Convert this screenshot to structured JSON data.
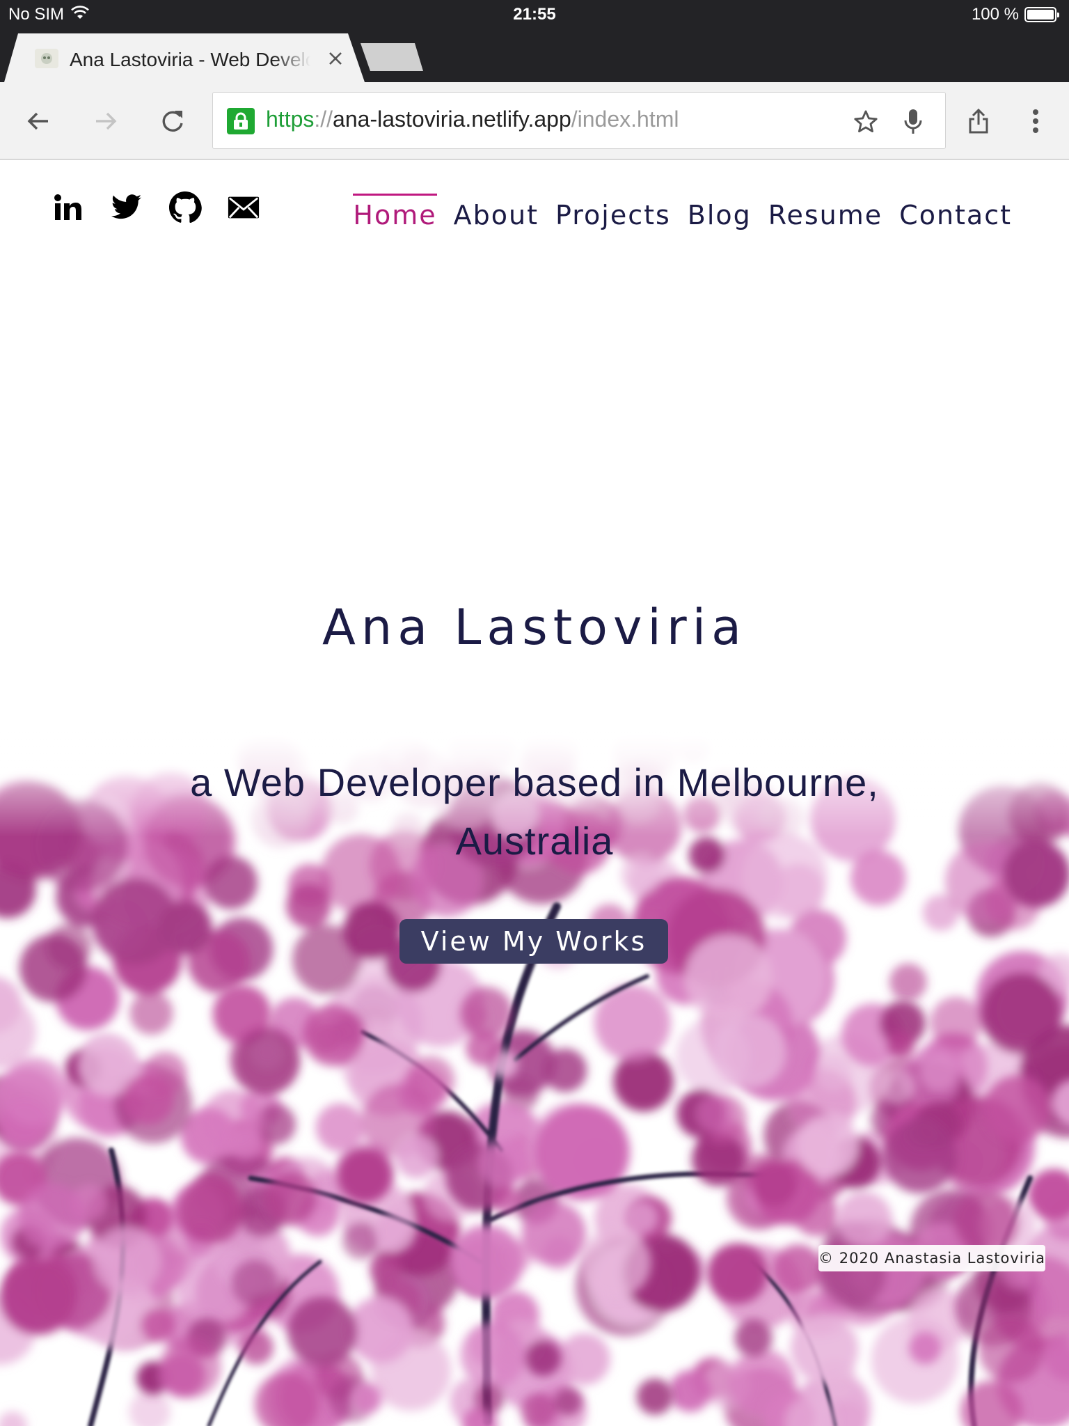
{
  "status_bar": {
    "carrier": "No SIM",
    "time": "21:55",
    "battery_text": "100 %",
    "battery_level": 1.0
  },
  "browser": {
    "active_tab_title": "Ana Lastoviria - Web Developer",
    "url": {
      "scheme": "https",
      "separator": "://",
      "host": "ana-lastoviria.netlify.app",
      "path": "/index.html"
    },
    "colors": {
      "secure": "#1fa932",
      "chrome": "#232326",
      "toolbar": "#f2f2f2"
    }
  },
  "page": {
    "social_icons": [
      "linkedin-icon",
      "twitter-icon",
      "github-icon",
      "mail-icon"
    ],
    "nav": [
      {
        "label": "Home",
        "active": true
      },
      {
        "label": "About",
        "active": false
      },
      {
        "label": "Projects",
        "active": false
      },
      {
        "label": "Blog",
        "active": false
      },
      {
        "label": "Resume",
        "active": false
      },
      {
        "label": "Contact",
        "active": false
      }
    ],
    "hero": {
      "name": "Ana Lastoviria",
      "tagline": "a Web Developer based in Melbourne, Australia",
      "cta_label": "View My Works"
    },
    "copyright": "© 2020 Anastasia Lastoviria",
    "colors": {
      "text": "#1b1b45",
      "accent": "#c01880",
      "button": "#3b3d62",
      "blossom": "#c2509f"
    }
  }
}
